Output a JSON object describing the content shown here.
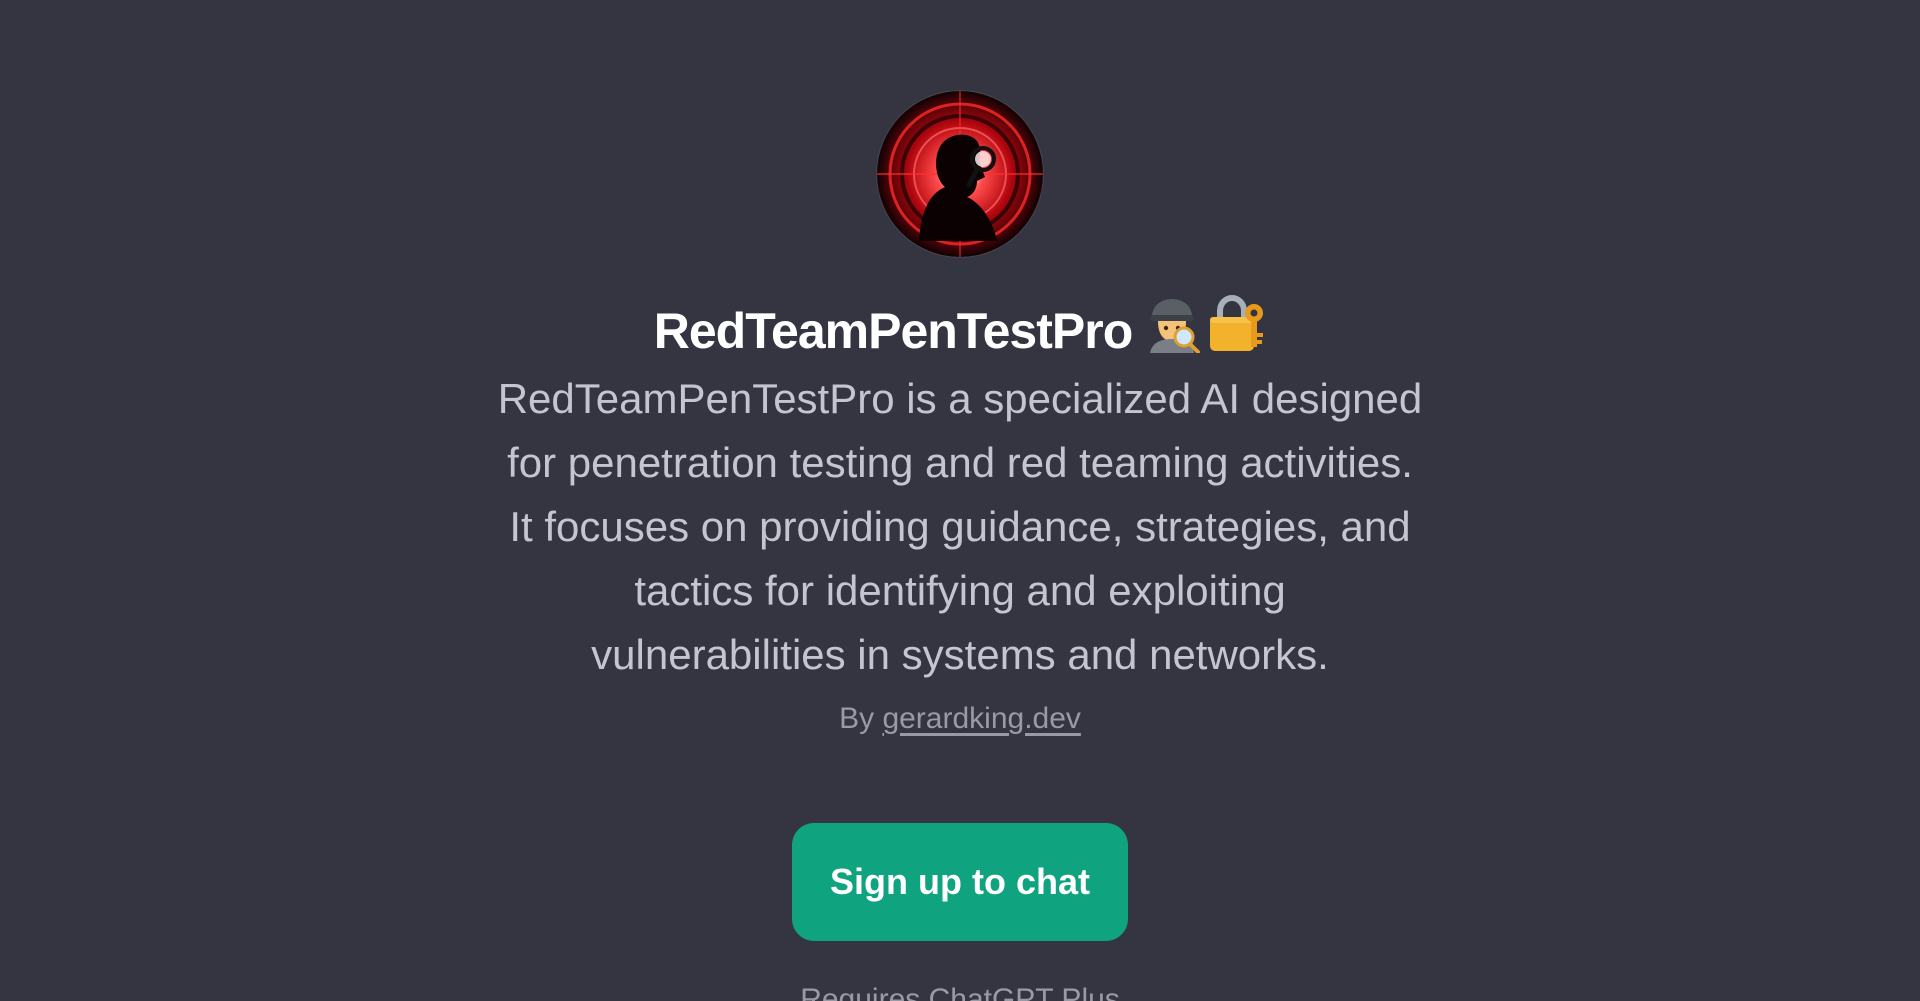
{
  "gpt": {
    "avatar_icon": "hooded-figure-magnifier-icon",
    "title": "RedTeamPenTestPro",
    "title_emojis": [
      "detective-icon",
      "locked-with-key-icon"
    ],
    "description_lines": [
      "RedTeamPenTestPro is a specialized AI designed",
      "for penetration testing and red teaming activities.",
      "It focuses on providing guidance, strategies, and",
      "tactics for identifying and exploiting",
      "vulnerabilities in systems and networks."
    ],
    "byline_prefix": "By",
    "author": "gerardking.dev"
  },
  "cta": {
    "label": "Sign up to chat"
  },
  "footer": {
    "text": "Requires ChatGPT Plus"
  },
  "colors": {
    "background": "#343541",
    "cta": "#10a37f",
    "avatar_red": "#d4141c"
  }
}
